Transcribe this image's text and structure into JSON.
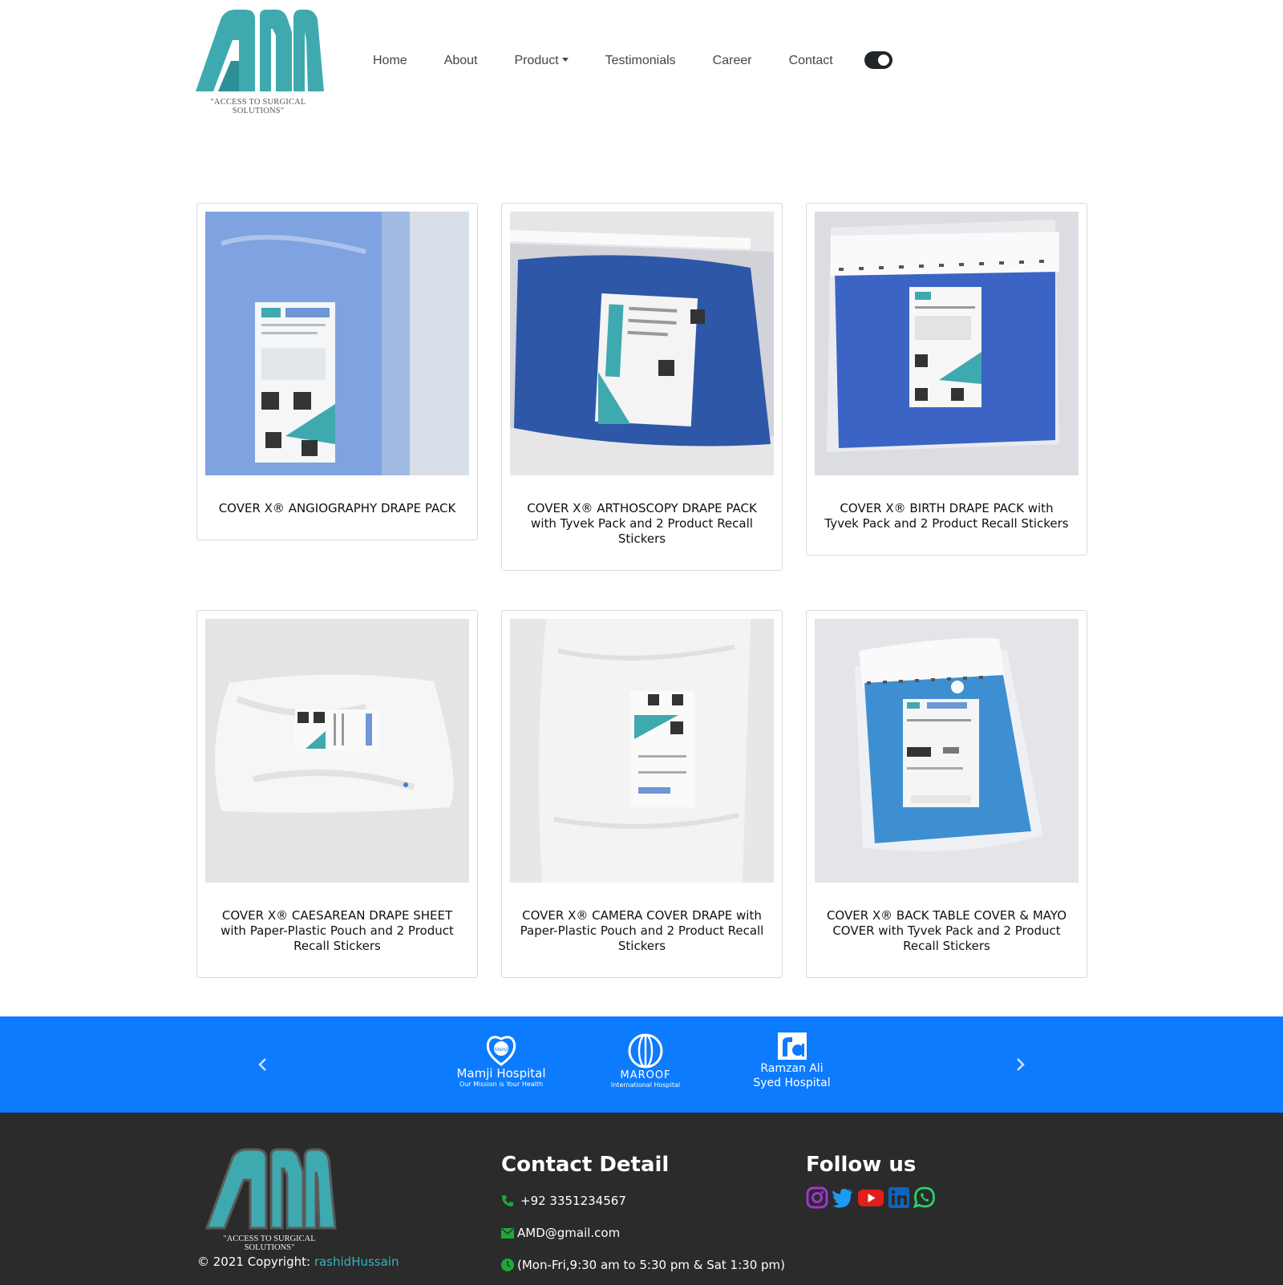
{
  "header": {
    "logo_tagline": "\"ACCESS TO SURGICAL SOLUTIONS\"",
    "nav": [
      "Home",
      "About",
      "Product",
      "Testimonials",
      "Career",
      "Contact"
    ]
  },
  "products": [
    {
      "title": "COVER X® ANGIOGRAPHY DRAPE PACK"
    },
    {
      "title": "COVER X® ARTHOSCOPY DRAPE PACK with Tyvek Pack and 2 Product Recall Stickers"
    },
    {
      "title": "COVER X® BIRTH DRAPE PACK with Tyvek Pack and 2 Product Recall Stickers"
    },
    {
      "title": "COVER X® CAESAREAN DRAPE SHEET with Paper-Plastic Pouch and 2 Product Recall Stickers"
    },
    {
      "title": "COVER X® CAMERA COVER DRAPE with Paper-Plastic Pouch and 2 Product Recall Stickers"
    },
    {
      "title": "COVER X® BACK TABLE COVER & MAYO COVER with Tyvek Pack and 2 Product Recall Stickers"
    }
  ],
  "partners": {
    "mamji_name": "Mamji Hospital",
    "mamji_tagline": "Our Mission is Your Health",
    "mamji_badge": "Mamji",
    "maroof_name": "MAROOF",
    "maroof_sub": "International Hospital",
    "ramzan_name": "Ramzan Ali Syed Hospital"
  },
  "footer": {
    "logo_tagline": "\"ACCESS TO SURGICAL SOLUTIONS\"",
    "copyright_prefix": "© 2021 Copyright: ",
    "copyright_author": "rashidHussain",
    "contact_heading": "Contact Detail",
    "phone": "+92 3351234567",
    "email": "AMD@gmail.com",
    "hours": "(Mon-Fri,9:30 am to 5:30 pm & Sat 1:30 pm)",
    "follow_heading": "Follow us"
  },
  "colors": {
    "brand_teal": "#3fa9b0",
    "partner_band": "#0d7bfd",
    "footer_bg": "#2b2b2b"
  },
  "icons": [
    "instagram-icon",
    "twitter-icon",
    "youtube-icon",
    "linkedin-icon",
    "whatsapp-icon",
    "phone-icon",
    "envelope-icon",
    "clock-icon",
    "chevron-left-icon",
    "chevron-right-icon"
  ]
}
